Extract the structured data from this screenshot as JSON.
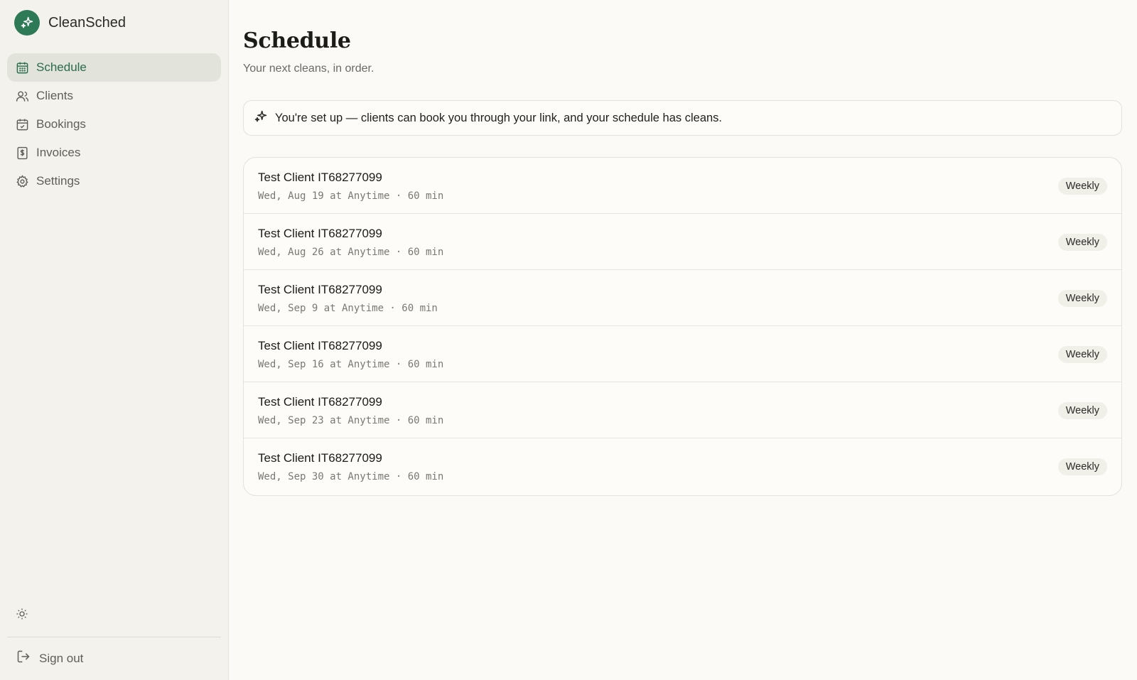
{
  "app": {
    "name": "CleanSched",
    "accent": "#2e7a57"
  },
  "sidebar": {
    "items": [
      {
        "label": "Schedule",
        "icon": "calendar-grid-icon",
        "active": true
      },
      {
        "label": "Clients",
        "icon": "users-icon",
        "active": false
      },
      {
        "label": "Bookings",
        "icon": "calendar-check-icon",
        "active": false
      },
      {
        "label": "Invoices",
        "icon": "invoice-dollar-icon",
        "active": false
      },
      {
        "label": "Settings",
        "icon": "gear-icon",
        "active": false
      }
    ],
    "theme_icon": "sun-icon",
    "signout_label": "Sign out"
  },
  "main": {
    "title": "Schedule",
    "subtitle": "Your next cleans, in order.",
    "notice": "You're set up — clients can book you through your link, and your schedule has cleans.",
    "rows": [
      {
        "client": "Test Client IT68277099",
        "meta": "Wed, Aug 19 at Anytime · 60 min",
        "badge": "Weekly"
      },
      {
        "client": "Test Client IT68277099",
        "meta": "Wed, Aug 26 at Anytime · 60 min",
        "badge": "Weekly"
      },
      {
        "client": "Test Client IT68277099",
        "meta": "Wed, Sep 9 at Anytime · 60 min",
        "badge": "Weekly"
      },
      {
        "client": "Test Client IT68277099",
        "meta": "Wed, Sep 16 at Anytime · 60 min",
        "badge": "Weekly"
      },
      {
        "client": "Test Client IT68277099",
        "meta": "Wed, Sep 23 at Anytime · 60 min",
        "badge": "Weekly"
      },
      {
        "client": "Test Client IT68277099",
        "meta": "Wed, Sep 30 at Anytime · 60 min",
        "badge": "Weekly"
      }
    ]
  }
}
